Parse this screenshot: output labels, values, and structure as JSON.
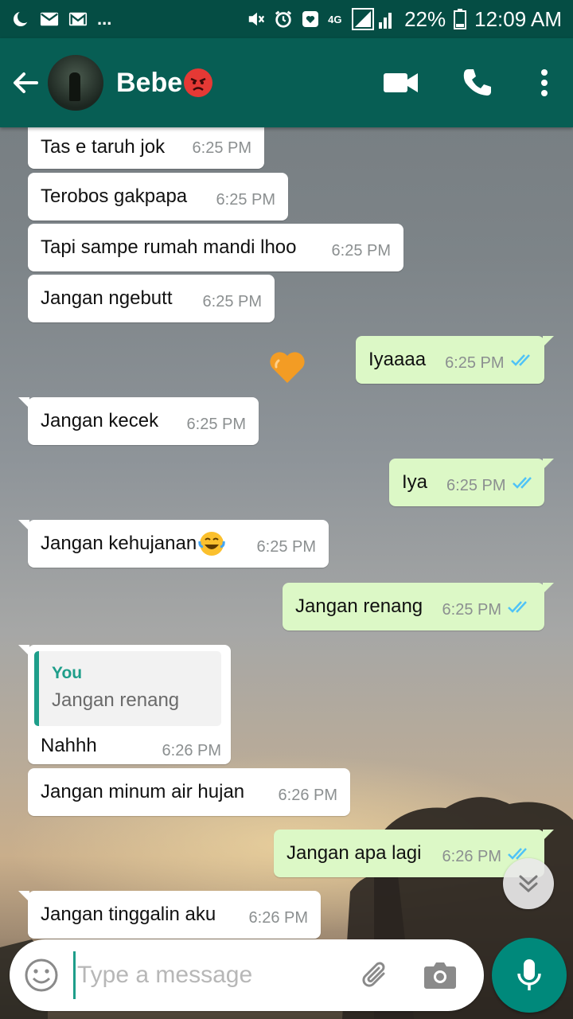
{
  "status_bar": {
    "signal_type": "4G",
    "battery": "22%",
    "time": "12:09 AM",
    "overflow": "...",
    "icons": [
      "moon-icon",
      "mail-icon",
      "gmail-icon",
      "mute-icon",
      "alarm-icon",
      "heart-app-icon",
      "signal-icon",
      "battery-icon"
    ]
  },
  "header": {
    "contact_name": "Bebe",
    "name_emoji": "angry-face-emoji",
    "colors": {
      "status_bar": "#054d44",
      "app_bar": "#075e54"
    }
  },
  "messages": [
    {
      "direction": "in",
      "text": "Tas e taruh jok",
      "time": "6:25 PM"
    },
    {
      "direction": "in",
      "text": "Terobos gakpapa",
      "time": "6:25 PM"
    },
    {
      "direction": "in",
      "text": "Tapi sampe rumah mandi lhoo",
      "time": "6:25 PM"
    },
    {
      "direction": "in",
      "text": "Jangan ngebutt",
      "time": "6:25 PM"
    },
    {
      "direction": "in",
      "text": "",
      "emoji": "orange-heart-emoji"
    },
    {
      "direction": "out",
      "text": "Iyaaaa",
      "time": "6:25 PM",
      "status": "read"
    },
    {
      "direction": "in",
      "text": "Jangan kecek",
      "time": "6:25 PM"
    },
    {
      "direction": "out",
      "text": "Iya",
      "time": "6:25 PM",
      "status": "read"
    },
    {
      "direction": "in",
      "text": "Jangan kehujanan",
      "emoji": "tears-of-joy-emoji",
      "time": "6:25 PM"
    },
    {
      "direction": "out",
      "text": "Jangan renang",
      "time": "6:25 PM",
      "status": "read"
    },
    {
      "direction": "in",
      "text": "Nahhh",
      "time": "6:26 PM",
      "quote": {
        "author": "You",
        "text": "Jangan renang"
      }
    },
    {
      "direction": "in",
      "text": "Jangan minum air hujan",
      "time": "6:26 PM"
    },
    {
      "direction": "out",
      "text": "Jangan apa lagi",
      "time": "6:26 PM",
      "status": "read"
    },
    {
      "direction": "in",
      "text": "Jangan tinggalin aku",
      "time": "6:26 PM"
    }
  ],
  "input": {
    "placeholder": "Type a message",
    "value": ""
  },
  "colors": {
    "incoming_bubble": "#ffffff",
    "outgoing_bubble": "#dcf8c6",
    "read_ticks": "#4fc3f7",
    "accent": "#00897b"
  }
}
